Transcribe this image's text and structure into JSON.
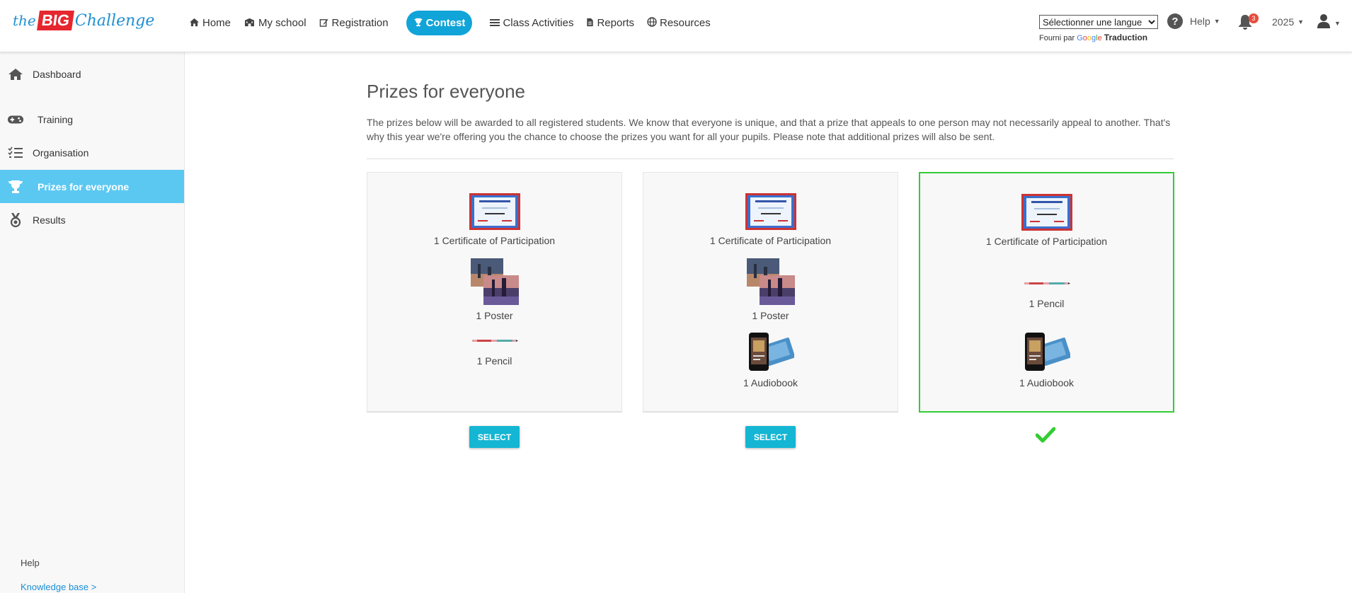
{
  "logo": {
    "the": "the",
    "big": "BIG",
    "challenge": "Challenge"
  },
  "nav": [
    {
      "id": "home",
      "label": "Home",
      "icon": "home-icon"
    },
    {
      "id": "my-school",
      "label": "My school",
      "icon": "school-icon"
    },
    {
      "id": "registration",
      "label": "Registration",
      "icon": "edit-icon"
    },
    {
      "id": "contest",
      "label": "Contest",
      "icon": "trophy-icon",
      "active": true
    },
    {
      "id": "class-activities",
      "label": "Class Activities",
      "icon": "list-icon"
    },
    {
      "id": "reports",
      "label": "Reports",
      "icon": "document-icon"
    },
    {
      "id": "resources",
      "label": "Resources",
      "icon": "globe-icon"
    }
  ],
  "language": {
    "selected": "Sélectionner une langue",
    "powered_by": "Fourni par",
    "google": "Google",
    "translate": "Traduction"
  },
  "header": {
    "help": "Help",
    "notifications": "3",
    "year": "2025"
  },
  "sidebar": {
    "items": [
      {
        "label": "Dashboard",
        "icon": "home-icon"
      },
      {
        "label": "Training",
        "icon": "gamepad-icon"
      },
      {
        "label": "Organisation",
        "icon": "checklist-icon"
      },
      {
        "label": "Prizes for everyone",
        "icon": "trophy-icon",
        "active": true
      },
      {
        "label": "Results",
        "icon": "medal-icon"
      }
    ],
    "help": "Help",
    "knowledge_base": "Knowledge base >"
  },
  "main": {
    "title": "Prizes for everyone",
    "intro": "The prizes below will be awarded to all registered students. We know that everyone is unique, and that a prize that appeals to one person may not necessarily appeal to another. That's why this year we're offering you the chance to choose the prizes you want for all your pupils. Please note that additional prizes will also be sent.",
    "cards": [
      {
        "prizes": [
          "1 Certificate of Participation",
          "1 Poster",
          "1 Pencil"
        ],
        "action": "SELECT",
        "selected": false
      },
      {
        "prizes": [
          "1 Certificate of Participation",
          "1 Poster",
          "1 Audiobook"
        ],
        "action": "SELECT",
        "selected": false
      },
      {
        "prizes": [
          "1 Certificate of Participation",
          "1 Pencil",
          "1 Audiobook"
        ],
        "selected": true
      }
    ]
  },
  "colors": {
    "accent": "#11a4d8",
    "sidebar_active": "#5bc8f2",
    "selected_border": "#33cc33",
    "check": "#33cc33",
    "select_button": "#14b6d3"
  }
}
